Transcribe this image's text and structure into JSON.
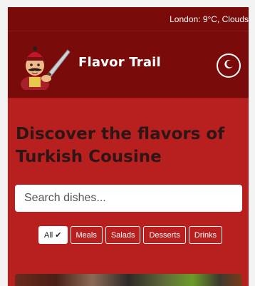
{
  "weather": {
    "text": "London: 9°C, Clouds"
  },
  "header": {
    "brand": "Flavor Trail",
    "theme_icon": "moon-icon",
    "logo_icon": "chef-logo-icon"
  },
  "hero": {
    "headline": "Discover the flavors of Turkish Cousine"
  },
  "search": {
    "placeholder": "Search dishes..."
  },
  "filters": {
    "items": [
      "All ✔",
      "Meals",
      "Salads",
      "Desserts",
      "Drinks"
    ],
    "active": "All ✔"
  },
  "colors": {
    "topbar": "#7a0b0b",
    "background": "#b82020",
    "headline": "#2e1616"
  }
}
